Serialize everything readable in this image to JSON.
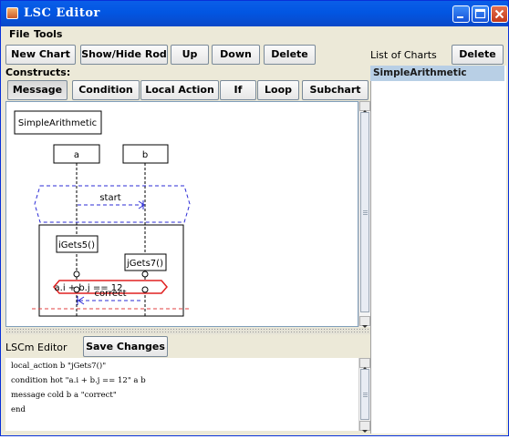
{
  "window": {
    "title": "LSC Editor"
  },
  "menu": {
    "file": "File",
    "tools": "Tools"
  },
  "toolbar": {
    "new_chart": "New Chart",
    "show_hide_rod": "Show/Hide Rod",
    "up": "Up",
    "down": "Down",
    "delete": "Delete"
  },
  "charts_panel": {
    "title": "List of Charts",
    "delete": "Delete",
    "items": [
      "SimpleArithmetic"
    ]
  },
  "constructs": {
    "label": "Constructs:",
    "buttons": [
      "Message",
      "Condition",
      "Local Action",
      "If",
      "Loop",
      "Subchart"
    ],
    "selected": "Message"
  },
  "diagram": {
    "chart_name": "SimpleArithmetic",
    "instances": [
      "a",
      "b"
    ],
    "prechart_message": "start",
    "actions": [
      "iGets5()",
      "jGets7()"
    ],
    "condition": "a.i + b.j == 12",
    "main_message": "correct"
  },
  "lscm": {
    "label": "LSCm Editor",
    "save": "Save Changes",
    "lines": [
      "local_action b \"jGets7()\"",
      "condition hot \"a.i + b.j == 12\" a b",
      "message cold b a \"correct\"",
      "end"
    ]
  },
  "colors": {
    "title_bar": "#0a5ee8",
    "selection": "#b8cfe5",
    "prechart": "#2b2bd6",
    "hot_condition": "#e02020",
    "cut": "#e04040"
  }
}
